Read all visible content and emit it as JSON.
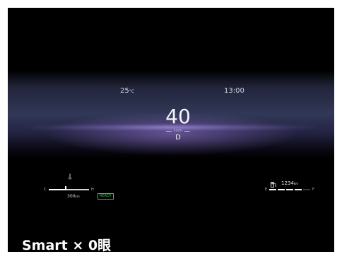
{
  "hud": {
    "temperature": {
      "value": "25",
      "unit": "°C"
    },
    "clock": "13:00",
    "speed": {
      "value": "40",
      "unit": "km/h"
    },
    "gear": "D"
  },
  "left_gauge": {
    "icon": "thermometer-icon",
    "low_label": "C",
    "high_label": "H",
    "level": 0.4,
    "range": {
      "value": "300",
      "unit": "km"
    },
    "ready_badge": "READY",
    "ready_color": "#39c24f"
  },
  "right_gauge": {
    "icon": "fuel-pump-icon",
    "odometer": {
      "value": "1234",
      "unit": "km"
    },
    "low_label": "E",
    "high_label": "F",
    "segments_total": 5,
    "segments_on": 4
  },
  "caption": "Smart × 0眼",
  "colors": {
    "background": "#000000",
    "glow": "#a48ce0",
    "text": "#f4f4fa"
  }
}
